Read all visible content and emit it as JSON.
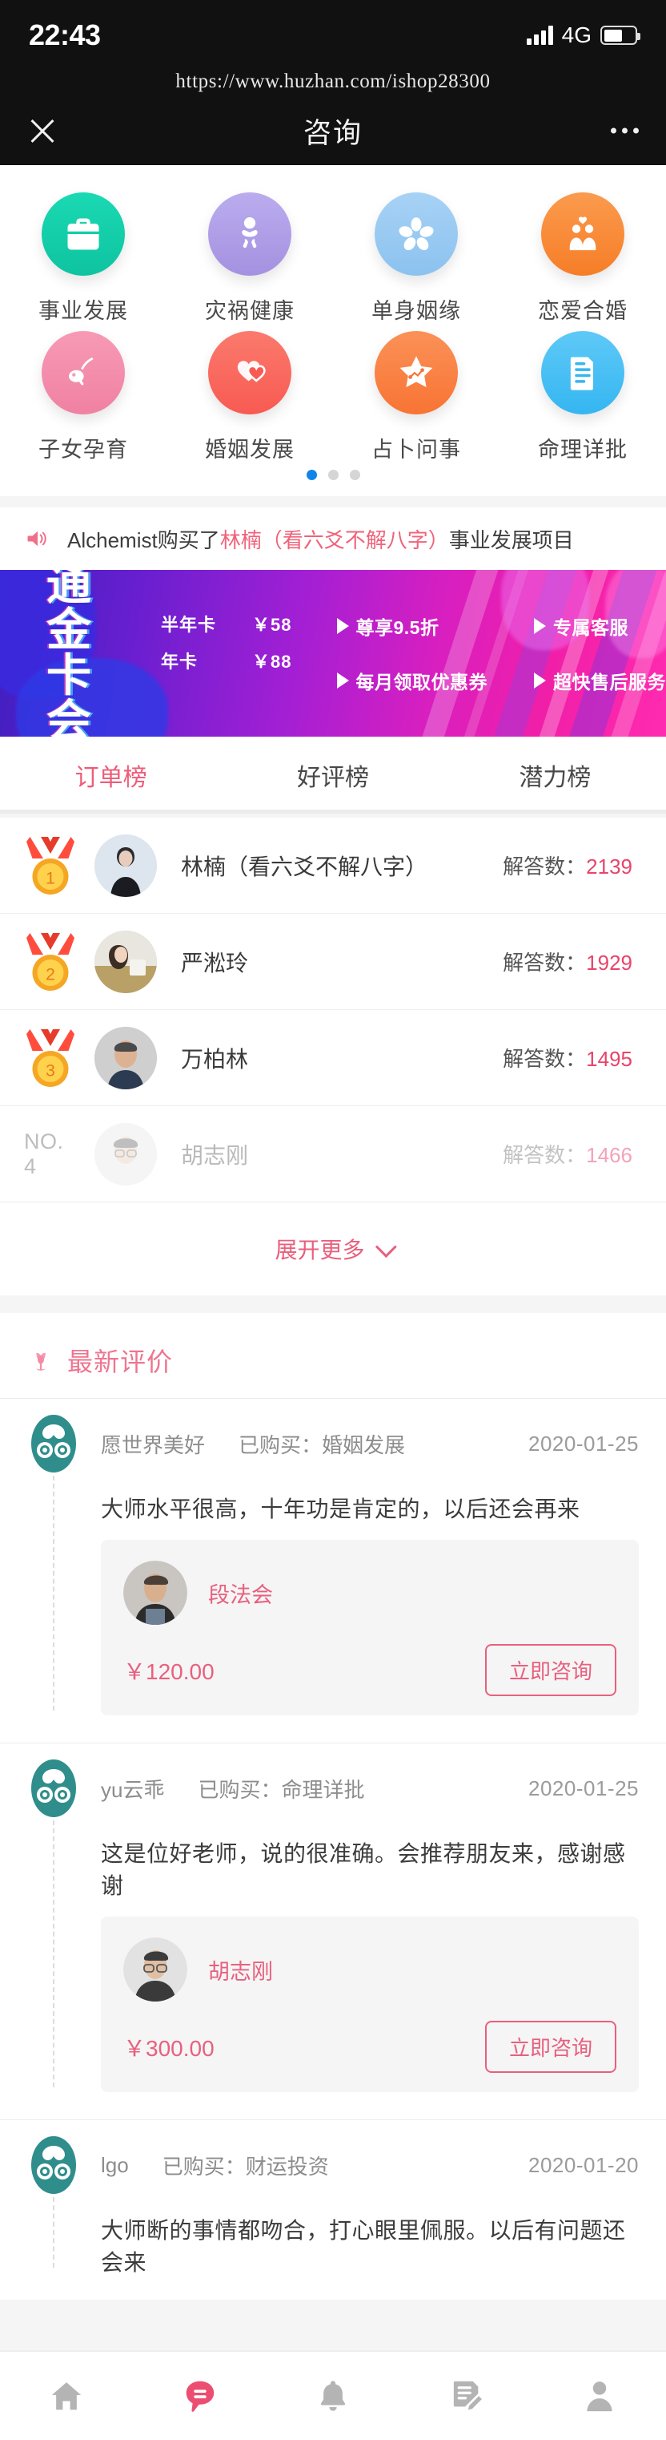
{
  "statusbar": {
    "time": "22:43",
    "network": "4G",
    "signal_icon": "signal-bars-icon",
    "battery_icon": "battery-icon"
  },
  "browser": {
    "url": "https://www.huzhan.com/ishop28300"
  },
  "navbar": {
    "title": "咨询",
    "close_icon": "close-icon",
    "more_icon": "more-dots-icon"
  },
  "categories": {
    "rows": [
      [
        {
          "label": "事业发展",
          "icon": "briefcase-icon",
          "color": "#18d1ac",
          "color2": "#0fc4a2"
        },
        {
          "label": "灾祸健康",
          "icon": "baby-icon",
          "color": "#b3a3e8",
          "color2": "#a18ee0"
        },
        {
          "label": "单身姻缘",
          "icon": "flower-icon",
          "color": "#9fcdf2",
          "color2": "#8ec4ef"
        },
        {
          "label": "恋爱合婚",
          "icon": "couple-heart-icon",
          "color": "#f89243",
          "color2": "#f5822e"
        }
      ],
      [
        {
          "label": "子女孕育",
          "icon": "stork-baby-icon",
          "color": "#f58fae",
          "color2": "#f27fa2"
        },
        {
          "label": "婚姻发展",
          "icon": "two-hearts-icon",
          "color": "#fa6a62",
          "color2": "#f85a52"
        },
        {
          "label": "占卜问事",
          "icon": "star-chart-icon",
          "color": "#fa8246",
          "color2": "#f87434"
        },
        {
          "label": "命理详批",
          "icon": "document-lines-icon",
          "color": "#4ec3f5",
          "color2": "#36b8f2"
        }
      ]
    ],
    "pager": {
      "total": 3,
      "active": 0
    }
  },
  "notice": {
    "icon": "speaker-icon",
    "prefix": "Alchemist购买了",
    "highlight": "林楠（看六爻不解八字）",
    "suffix": "事业发展项目"
  },
  "banner": {
    "title_line1": "开通",
    "title_line2": "金卡会员",
    "prices": [
      {
        "name": "半年卡",
        "value": "￥58"
      },
      {
        "name": "年卡",
        "value": "￥88"
      }
    ],
    "features": [
      "尊享9.5折",
      "专属客服",
      "每月领取优惠券",
      "超快售后服务"
    ]
  },
  "tabs": [
    {
      "label": "订单榜",
      "active": true
    },
    {
      "label": "好评榜",
      "active": false
    },
    {
      "label": "潜力榜",
      "active": false
    }
  ],
  "rank": {
    "metric_label": "解答数：",
    "rows": [
      {
        "rank": "1",
        "badge": "medal",
        "name": "林楠（看六爻不解八字）",
        "count": "2139",
        "faded": false,
        "avatar_color": "#dde6ef"
      },
      {
        "rank": "2",
        "badge": "medal",
        "name": "严淞玲",
        "count": "1929",
        "faded": false,
        "avatar_color": "#cdd9c8"
      },
      {
        "rank": "3",
        "badge": "medal",
        "name": "万柏林",
        "count": "1495",
        "faded": false,
        "avatar_color": "#cfcfcf"
      },
      {
        "rank": "NO. 4",
        "badge": "text",
        "name": "胡志刚",
        "count": "1466",
        "faded": true,
        "avatar_color": "#d8d8d8"
      }
    ],
    "expand_label": "展开更多",
    "expand_icon": "chevron-down-icon"
  },
  "reviews": {
    "section_icon": "tulip-icon",
    "section_title": "最新评价",
    "purchased_label": "已购买：",
    "items": [
      {
        "avatar_icon": "owl-avatar-icon",
        "user": "愿世界美好",
        "product_category": "婚姻发展",
        "date": "2020-01-25",
        "text": "大师水平很高，十年功是肯定的，以后还会再来",
        "master": {
          "name": "段法会",
          "price": "￥120.00",
          "button": "立即咨询",
          "avatar_color": "#c9c6c2"
        }
      },
      {
        "avatar_icon": "owl-avatar-icon",
        "user": "yu云乖",
        "product_category": "命理详批",
        "date": "2020-01-25",
        "text": "这是位好老师，说的很准确。会推荐朋友来，感谢感谢",
        "master": {
          "name": "胡志刚",
          "price": "￥300.00",
          "button": "立即咨询",
          "avatar_color": "#d3d3d3"
        }
      },
      {
        "avatar_icon": "owl-avatar-icon",
        "user": "lgo",
        "product_category": "财运投资",
        "date": "2020-01-20",
        "text": "大师断的事情都吻合，打心眼里佩服。以后有问题还会来",
        "master": null
      }
    ]
  },
  "bottomnav": {
    "items": [
      {
        "icon": "home-icon",
        "active": false
      },
      {
        "icon": "message-bubble-icon",
        "active": true
      },
      {
        "icon": "bell-icon",
        "active": false
      },
      {
        "icon": "order-edit-icon",
        "active": false
      },
      {
        "icon": "person-icon",
        "active": false
      }
    ],
    "accent": "#ec4e72"
  }
}
